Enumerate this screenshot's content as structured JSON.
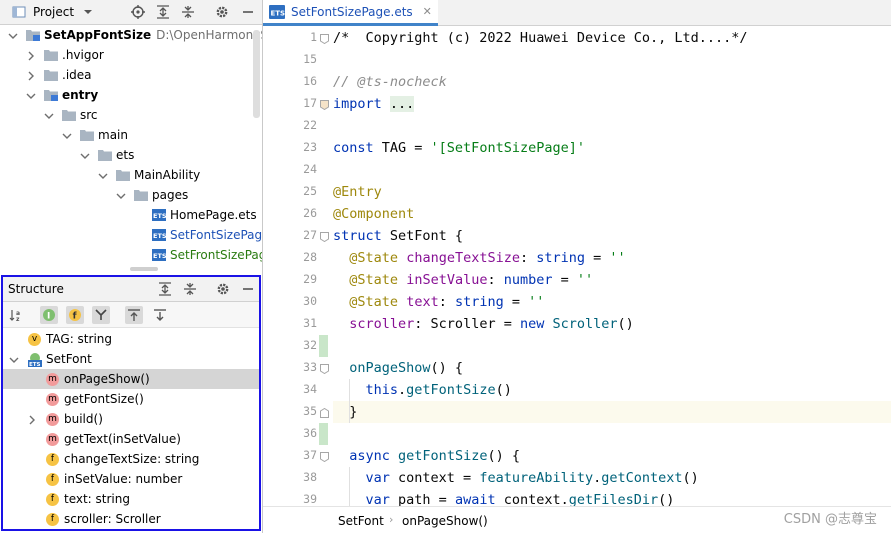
{
  "project_panel": {
    "title": "Project",
    "tree": [
      {
        "label": "SetAppFontSize",
        "path": "D:\\OpenHarmonySDK\\c",
        "icon": "module-folder-icon",
        "expanded": true,
        "depth": 0,
        "style": "bold"
      },
      {
        "label": ".hvigor",
        "icon": "folder-icon",
        "expanded": false,
        "depth": 1
      },
      {
        "label": ".idea",
        "icon": "folder-icon",
        "expanded": false,
        "depth": 1
      },
      {
        "label": "entry",
        "icon": "module-folder-icon",
        "expanded": true,
        "depth": 1,
        "style": "bold"
      },
      {
        "label": "src",
        "icon": "folder-icon",
        "expanded": true,
        "depth": 2
      },
      {
        "label": "main",
        "icon": "folder-icon",
        "expanded": true,
        "depth": 3
      },
      {
        "label": "ets",
        "icon": "folder-icon",
        "expanded": true,
        "depth": 4
      },
      {
        "label": "MainAbility",
        "icon": "folder-icon",
        "expanded": true,
        "depth": 5
      },
      {
        "label": "pages",
        "icon": "folder-icon",
        "expanded": true,
        "depth": 6
      },
      {
        "label": "HomePage.ets",
        "icon": "ets-file-icon",
        "depth": 7,
        "style": "normal"
      },
      {
        "label": "SetFontSizePage.e",
        "icon": "ets-file-icon",
        "depth": 7,
        "style": "blue"
      },
      {
        "label": "SetFrontSizePageI",
        "icon": "ets-file-icon",
        "depth": 7,
        "style": "green"
      }
    ]
  },
  "structure_panel": {
    "title": "Structure",
    "items": [
      {
        "label": "TAG: string",
        "badge": "v",
        "depth": 0
      },
      {
        "label": "SetFont",
        "badge": "ets-struct",
        "depth": 0,
        "expanded": true
      },
      {
        "label": "onPageShow()",
        "badge": "m",
        "depth": 1,
        "selected": true
      },
      {
        "label": "getFontSize()",
        "badge": "m",
        "depth": 1
      },
      {
        "label": "build()",
        "badge": "m",
        "depth": 1,
        "collapsible": true
      },
      {
        "label": "getText(inSetValue)",
        "badge": "m",
        "depth": 1
      },
      {
        "label": "changeTextSize: string",
        "badge": "f",
        "depth": 1
      },
      {
        "label": "inSetValue: number",
        "badge": "f",
        "depth": 1
      },
      {
        "label": "text: string",
        "badge": "f",
        "depth": 1
      },
      {
        "label": "scroller: Scroller",
        "badge": "f",
        "depth": 1
      }
    ]
  },
  "editor": {
    "tab_label": "SetFontSizePage.ets",
    "lines": [
      {
        "num": "1",
        "tokens": [
          [
            "plain",
            "/*  Copyright (c) 2022 Huawei Device Co., Ltd....*/"
          ]
        ],
        "mark": "fold"
      },
      {
        "num": "15",
        "tokens": []
      },
      {
        "num": "16",
        "tokens": [
          [
            "cmt",
            "// @ts-nocheck"
          ]
        ]
      },
      {
        "num": "17",
        "tokens": [
          [
            "kw",
            "import"
          ],
          [
            "plain",
            " "
          ],
          [
            "fold",
            "..."
          ]
        ],
        "mark": "fold-collapsed"
      },
      {
        "num": "22",
        "tokens": []
      },
      {
        "num": "23",
        "tokens": [
          [
            "kw",
            "const"
          ],
          [
            "plain",
            " TAG = "
          ],
          [
            "str",
            "'[SetFontSizePage]'"
          ]
        ]
      },
      {
        "num": "24",
        "tokens": []
      },
      {
        "num": "25",
        "tokens": [
          [
            "ann",
            "@Entry"
          ]
        ]
      },
      {
        "num": "26",
        "tokens": [
          [
            "ann",
            "@Component"
          ]
        ]
      },
      {
        "num": "27",
        "tokens": [
          [
            "kw",
            "struct"
          ],
          [
            "plain",
            " SetFont {"
          ]
        ],
        "mark": "fold"
      },
      {
        "num": "28",
        "tokens": [
          [
            "plain",
            "  "
          ],
          [
            "ann",
            "@State"
          ],
          [
            "plain",
            " "
          ],
          [
            "fld",
            "changeTextSize"
          ],
          [
            "plain",
            ": "
          ],
          [
            "kw",
            "string"
          ],
          [
            "plain",
            " = "
          ],
          [
            "str",
            "''"
          ]
        ]
      },
      {
        "num": "29",
        "tokens": [
          [
            "plain",
            "  "
          ],
          [
            "ann",
            "@State"
          ],
          [
            "plain",
            " "
          ],
          [
            "fld",
            "inSetValue"
          ],
          [
            "plain",
            ": "
          ],
          [
            "kw",
            "number"
          ],
          [
            "plain",
            " = "
          ],
          [
            "str",
            "''"
          ]
        ]
      },
      {
        "num": "30",
        "tokens": [
          [
            "plain",
            "  "
          ],
          [
            "ann",
            "@State"
          ],
          [
            "plain",
            " "
          ],
          [
            "fld",
            "text"
          ],
          [
            "plain",
            ": "
          ],
          [
            "kw",
            "string"
          ],
          [
            "plain",
            " = "
          ],
          [
            "str",
            "''"
          ]
        ]
      },
      {
        "num": "31",
        "tokens": [
          [
            "plain",
            "  "
          ],
          [
            "fld",
            "scroller"
          ],
          [
            "plain",
            ": Scroller = "
          ],
          [
            "kw",
            "new"
          ],
          [
            "plain",
            " "
          ],
          [
            "fn",
            "Scroller"
          ],
          [
            "plain",
            "()"
          ]
        ]
      },
      {
        "num": "32",
        "tokens": [],
        "mark": "change"
      },
      {
        "num": "33",
        "tokens": [
          [
            "plain",
            "  "
          ],
          [
            "fn",
            "onPageShow"
          ],
          [
            "plain",
            "() {"
          ]
        ],
        "mark": "fold"
      },
      {
        "num": "34",
        "tokens": [
          [
            "plain",
            "    "
          ],
          [
            "kw",
            "this"
          ],
          [
            "plain",
            "."
          ],
          [
            "fn",
            "getFontSize"
          ],
          [
            "plain",
            "()"
          ]
        ]
      },
      {
        "num": "35",
        "tokens": [
          [
            "plain",
            "  }"
          ]
        ],
        "mark": "fold-end",
        "current": true
      },
      {
        "num": "36",
        "tokens": [],
        "mark": "change"
      },
      {
        "num": "37",
        "tokens": [
          [
            "plain",
            "  "
          ],
          [
            "kw",
            "async"
          ],
          [
            "plain",
            " "
          ],
          [
            "fn",
            "getFontSize"
          ],
          [
            "plain",
            "() {"
          ]
        ],
        "mark": "fold"
      },
      {
        "num": "38",
        "tokens": [
          [
            "plain",
            "    "
          ],
          [
            "kw",
            "var"
          ],
          [
            "plain",
            " context = "
          ],
          [
            "fn",
            "featureAbility"
          ],
          [
            "plain",
            "."
          ],
          [
            "fn",
            "getContext"
          ],
          [
            "plain",
            "()"
          ]
        ]
      },
      {
        "num": "39",
        "tokens": [
          [
            "plain",
            "    "
          ],
          [
            "kw",
            "var"
          ],
          [
            "plain",
            " path = "
          ],
          [
            "kw",
            "await"
          ],
          [
            "plain",
            " context."
          ],
          [
            "fn",
            "getFilesDir"
          ],
          [
            "plain",
            "()"
          ]
        ]
      }
    ]
  },
  "breadcrumb": [
    "SetFont",
    "onPageShow()"
  ],
  "watermark": "CSDN @志尊宝",
  "colors": {
    "accent": "#1a12e6",
    "tab_underline": "#4083c9",
    "selection": "#d5d5d5"
  }
}
